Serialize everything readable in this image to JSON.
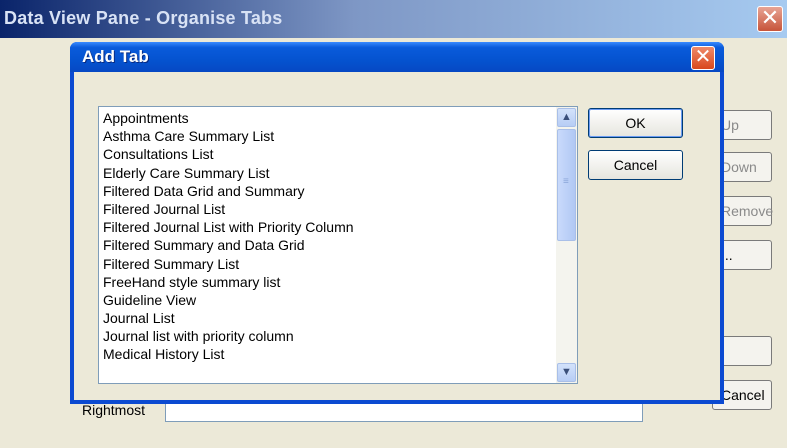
{
  "parent_window": {
    "title": "Data View Pane - Organise Tabs",
    "close_glyph": "✕",
    "buttons": [
      {
        "label": "Up",
        "enabled": false
      },
      {
        "label": "Down",
        "enabled": false
      },
      {
        "label": "Remove",
        "enabled": false
      },
      {
        "label": "...",
        "enabled": true
      },
      {
        "label": "",
        "enabled": true
      },
      {
        "label": "Cancel",
        "enabled": true
      }
    ],
    "rightmost_label": "Rightmost"
  },
  "dialog": {
    "title": "Add Tab",
    "close_glyph": "✕",
    "list_items": [
      "Appointments",
      "Asthma Care Summary List",
      "Consultations List",
      "Elderly Care Summary List",
      "Filtered Data Grid and Summary",
      "Filtered Journal List",
      "Filtered Journal List with Priority Column",
      "Filtered Summary and Data Grid",
      "Filtered Summary List",
      "FreeHand style summary list",
      "Guideline View",
      "Journal List",
      "Journal list with priority column",
      "Medical History List"
    ],
    "ok_label": "OK",
    "cancel_label": "Cancel",
    "scroll_up_glyph": "▲",
    "scroll_down_glyph": "▼",
    "grip_glyph": "≡"
  }
}
